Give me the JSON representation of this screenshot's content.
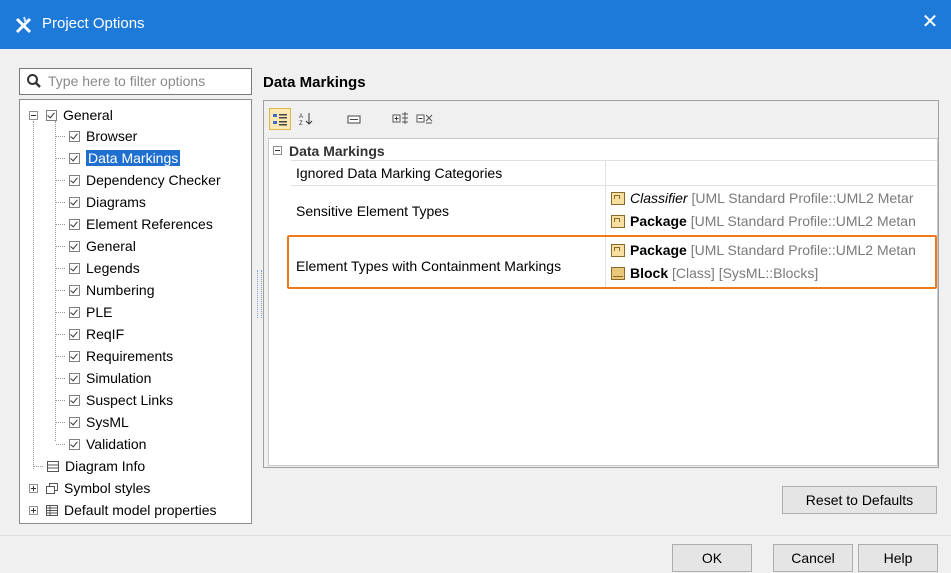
{
  "window": {
    "title": "Project Options",
    "close_glyph": "✕"
  },
  "filter": {
    "placeholder": "Type here to filter options"
  },
  "tree": {
    "root": "General",
    "children": [
      "Browser",
      "Data Markings",
      "Dependency Checker",
      "Diagrams",
      "Element References",
      "General",
      "Legends",
      "Numbering",
      "PLE",
      "ReqIF",
      "Requirements",
      "Simulation",
      "Suspect Links",
      "SysML",
      "Validation"
    ],
    "selected": "Data Markings",
    "others": [
      "Diagram Info",
      "Symbol styles",
      "Default model properties"
    ]
  },
  "panel": {
    "heading": "Data Markings",
    "toolbar": [
      "categorized-view-icon",
      "sort-alphabetic-icon",
      "hide-description-icon",
      "expand-all-icon",
      "collapse-all-icon"
    ],
    "group": "Data Markings",
    "properties": [
      {
        "name": "Ignored Data Marking Categories",
        "values": []
      },
      {
        "name": "Sensitive Element Types",
        "values": [
          {
            "icon": "classifier-icon",
            "main": "Classifier",
            "italic": true,
            "rest": "[UML Standard Profile::UML2 Metar"
          },
          {
            "icon": "package-icon",
            "main": "Package",
            "italic": false,
            "rest": "[UML Standard Profile::UML2 Metan"
          }
        ]
      },
      {
        "name": "Element Types with Containment Markings",
        "values": [
          {
            "icon": "package-icon",
            "main": "Package",
            "italic": false,
            "rest": "[UML Standard Profile::UML2 Metan"
          },
          {
            "icon": "block-icon",
            "main": "Block",
            "italic": false,
            "rest": "[Class] [SysML::Blocks]"
          }
        ]
      }
    ]
  },
  "buttons": {
    "reset": "Reset to Defaults",
    "ok": "OK",
    "cancel": "Cancel",
    "help": "Help"
  },
  "colors": {
    "titlebar": "#1e7ad8",
    "selection": "#1f6fd0",
    "highlight": "#f07a1a"
  }
}
